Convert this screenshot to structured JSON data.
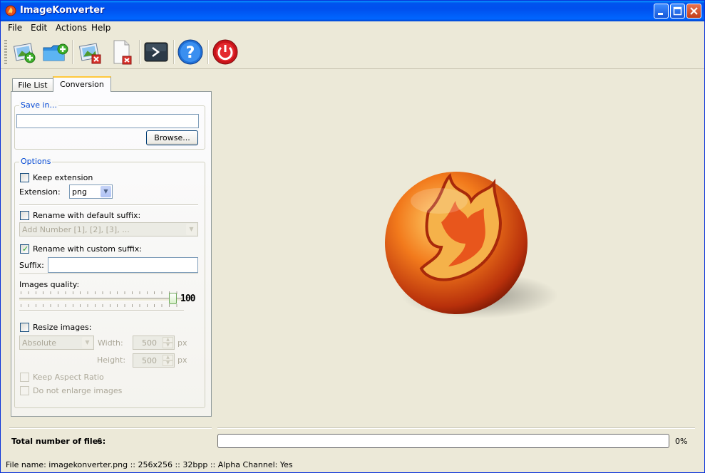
{
  "window": {
    "title": "ImageKonverter"
  },
  "menu": [
    "File",
    "Edit",
    "Actions",
    "Help"
  ],
  "toolbar": {
    "buttons": [
      {
        "name": "add-images-button",
        "icon": "add-images-icon"
      },
      {
        "name": "add-folder-button",
        "icon": "add-folder-icon"
      },
      {
        "name": "remove-images-button",
        "icon": "remove-images-icon"
      },
      {
        "name": "clear-list-button",
        "icon": "delete-document-icon"
      },
      {
        "name": "convert-button",
        "icon": "terminal-run-icon"
      },
      {
        "name": "help-button",
        "icon": "help-icon"
      },
      {
        "name": "exit-button",
        "icon": "power-icon"
      }
    ]
  },
  "tabs": {
    "file_list": "File List",
    "conversion": "Conversion"
  },
  "save_in": {
    "title": "Save in...",
    "path": "",
    "browse": "Browse..."
  },
  "options": {
    "title": "Options",
    "keep_extension": {
      "label": "Keep extension",
      "checked": false
    },
    "extension": {
      "label": "Extension:",
      "value": "png"
    },
    "rename_default": {
      "label": "Rename with default suffix:",
      "checked": false,
      "value": "Add Number [1], [2], [3], ..."
    },
    "rename_custom": {
      "label": "Rename with custom suffix:",
      "checked": true
    },
    "suffix": {
      "label": "Suffix:",
      "value": ""
    },
    "quality": {
      "label": "Images quality:",
      "value": "100",
      "fraction": 1.0
    },
    "resize": {
      "label": "Resize images:",
      "checked": false,
      "mode": "Absolute",
      "width_label": "Width:",
      "width": "500",
      "height_label": "Height:",
      "height": "500",
      "unit": "px"
    },
    "keep_aspect": {
      "label": "Keep Aspect Ratio",
      "checked": false
    },
    "no_enlarge": {
      "label": "Do not enlarge images",
      "checked": false
    }
  },
  "footer": {
    "total_label": "Total number of files:",
    "total_value": "6",
    "progress_percent": 0,
    "progress_text": "0%"
  },
  "status": "File name: imagekonverter.png :: 256x256 :: 32bpp :: Alpha Channel: Yes",
  "colors": {
    "title_bar": "#0054e3",
    "accent": "#0046d5",
    "check": "#21a121"
  }
}
